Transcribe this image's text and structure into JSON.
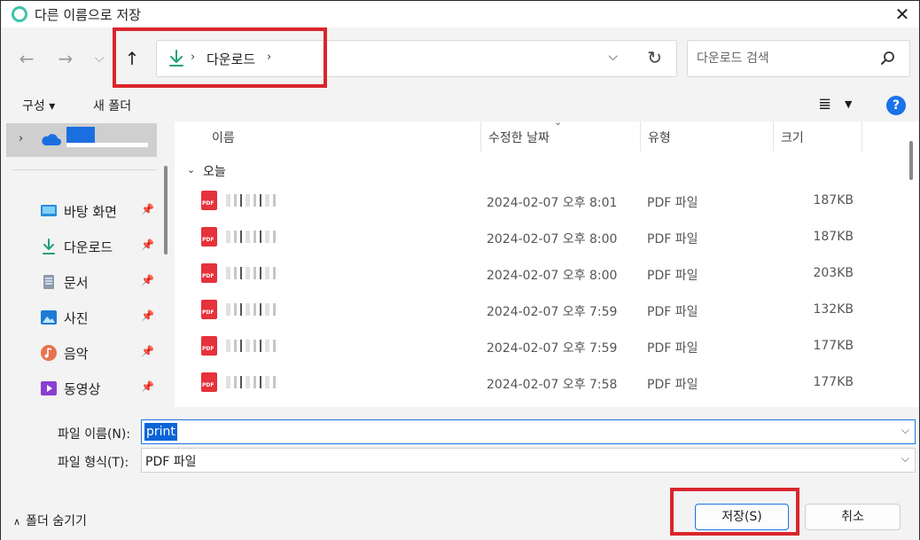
{
  "window": {
    "title": "다른 이름으로 저장",
    "close_glyph": "✕"
  },
  "nav": {
    "back_glyph": "←",
    "forward_glyph": "→",
    "recent_glyph": "⌵",
    "up_glyph": "↑",
    "separator_glyph": "›",
    "current_location": "다운로드",
    "address_dropdown_glyph": "⌵",
    "refresh_glyph": "↻"
  },
  "search": {
    "placeholder": "다운로드 검색"
  },
  "toolbar": {
    "organize_label": "구성 ▾",
    "new_folder_label": "새 폴더",
    "view_glyph": "≣",
    "view_dropdown_glyph": "▼",
    "help_glyph": "?"
  },
  "sidebar": {
    "chevron_glyph": "›",
    "pin_glyph": "📌",
    "items": [
      {
        "label": "바탕 화면",
        "icon": "desktop-icon"
      },
      {
        "label": "다운로드",
        "icon": "download-icon"
      },
      {
        "label": "문서",
        "icon": "document-icon"
      },
      {
        "label": "사진",
        "icon": "picture-icon"
      },
      {
        "label": "음악",
        "icon": "music-icon"
      },
      {
        "label": "동영상",
        "icon": "video-icon"
      }
    ]
  },
  "list": {
    "columns": {
      "name": "이름",
      "date": "수정한 날짜",
      "type": "유형",
      "size": "크기"
    },
    "sort_caret": "⌄",
    "group_label": "오늘",
    "group_chevron": "⌄",
    "rows": [
      {
        "date": "2024-02-07 오후 8:01",
        "type": "PDF 파일",
        "size": "187KB"
      },
      {
        "date": "2024-02-07 오후 8:00",
        "type": "PDF 파일",
        "size": "187KB"
      },
      {
        "date": "2024-02-07 오후 8:00",
        "type": "PDF 파일",
        "size": "203KB"
      },
      {
        "date": "2024-02-07 오후 7:59",
        "type": "PDF 파일",
        "size": "132KB"
      },
      {
        "date": "2024-02-07 오후 7:59",
        "type": "PDF 파일",
        "size": "177KB"
      },
      {
        "date": "2024-02-07 오후 7:58",
        "type": "PDF 파일",
        "size": "177KB"
      }
    ]
  },
  "form": {
    "filename_label": "파일 이름(N):",
    "filename_value": "print",
    "filetype_label": "파일 형식(T):",
    "filetype_value": "PDF 파일",
    "dropdown_glyph": "⌵"
  },
  "footer": {
    "hide_folders_chevron": "∧",
    "hide_folders_label": "폴더 숨기기",
    "save_label": "저장(S)",
    "cancel_label": "취소"
  },
  "colors": {
    "accent": "#1a73e8",
    "highlight": "#d9262c",
    "pdf": "#e5323b",
    "onedrive": "#1a6fe0"
  }
}
